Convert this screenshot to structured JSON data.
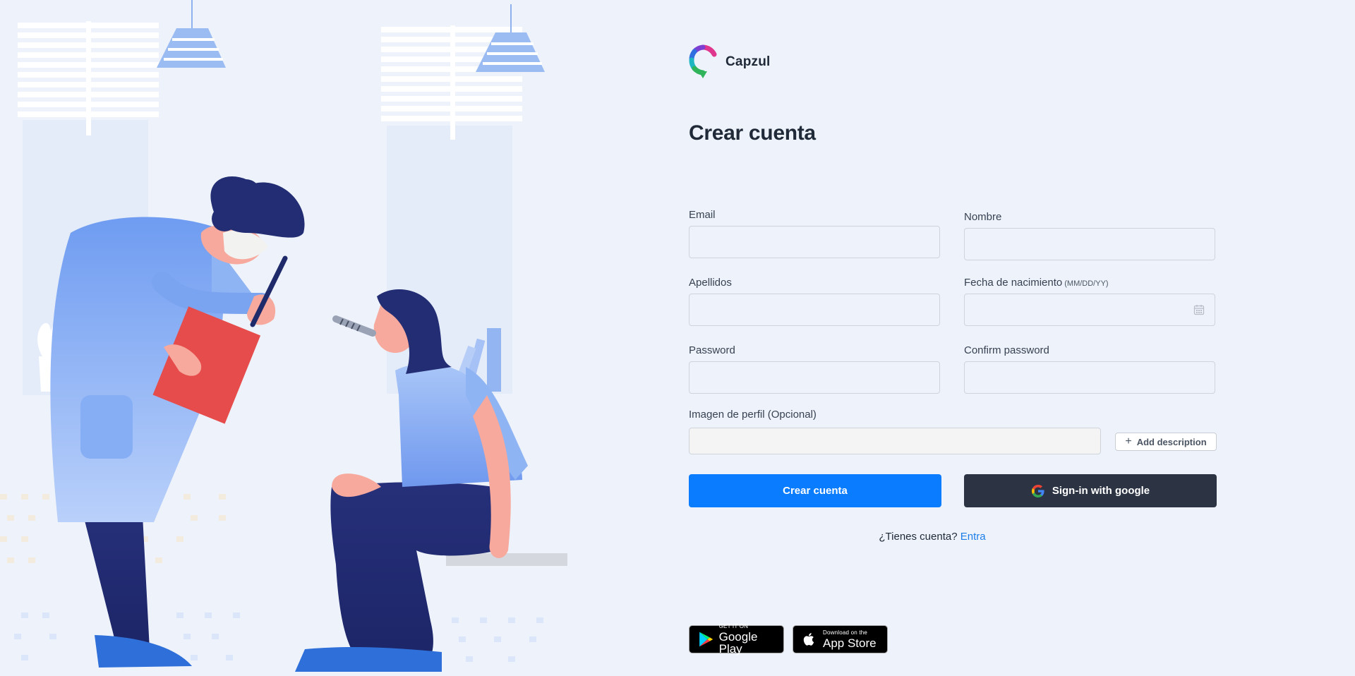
{
  "brand": {
    "name": "Capzul",
    "logo_icon": "capzul-logo-icon"
  },
  "page": {
    "title": "Crear cuenta"
  },
  "form": {
    "email": {
      "label": "Email",
      "value": ""
    },
    "nombre": {
      "label": "Nombre",
      "value": ""
    },
    "apellidos": {
      "label": "Apellidos",
      "value": ""
    },
    "fecha": {
      "label": "Fecha de nacimiento",
      "hint": "(MM/DD/YY)",
      "value": "",
      "icon": "calendar-icon"
    },
    "password": {
      "label": "Password",
      "value": ""
    },
    "confirm": {
      "label": "Confirm password",
      "value": ""
    },
    "imagen": {
      "label": "Imagen de perfil (Opcional)",
      "add_description": "Add description",
      "add_icon": "plus-icon"
    }
  },
  "buttons": {
    "create": "Crear cuenta",
    "google": "Sign-in with google",
    "google_icon": "google-icon"
  },
  "signin": {
    "prompt": "¿Tienes cuenta?",
    "link": "Entra"
  },
  "stores": {
    "google_play": {
      "small": "GET IT ON",
      "big": "Google Play",
      "icon": "google-play-icon"
    },
    "app_store": {
      "small": "Download on the",
      "big": "App Store",
      "icon": "apple-icon"
    }
  },
  "colors": {
    "background": "#eef3fb",
    "primary": "#0a7cff",
    "google_button": "#2c3444",
    "link": "#1d7ee8",
    "text": "#1f2937"
  }
}
